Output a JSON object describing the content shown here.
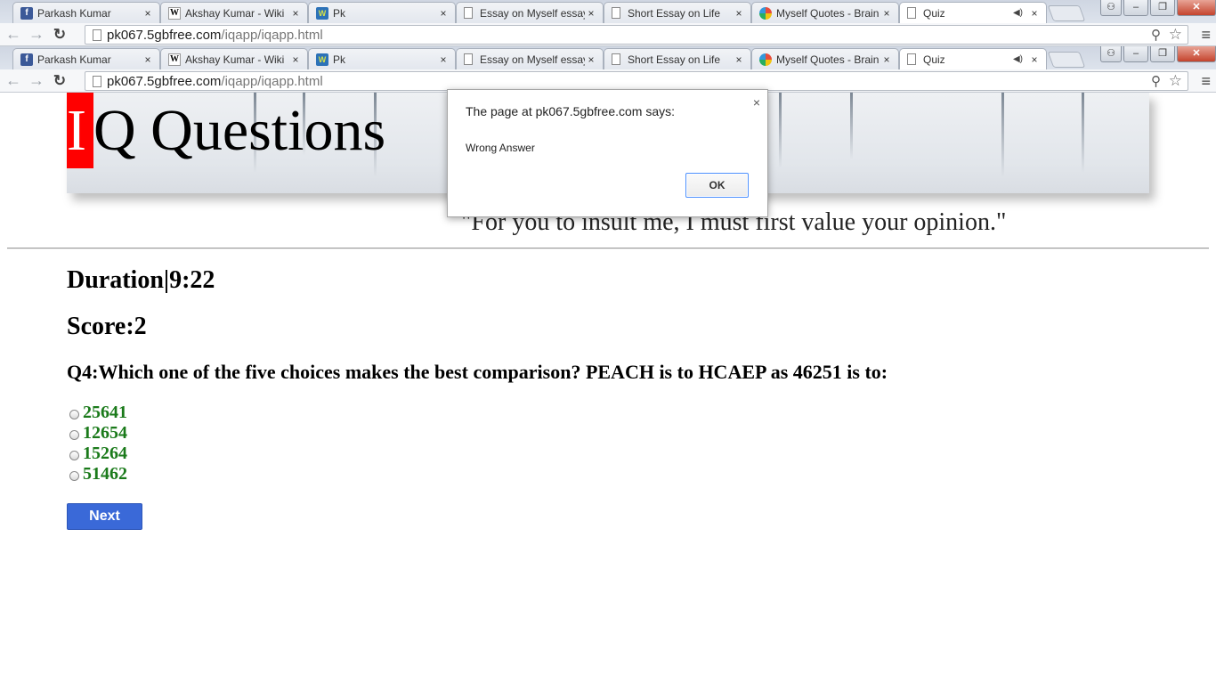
{
  "browser": {
    "tabs": [
      {
        "title": "Parkash Kumar",
        "icon": "facebook-icon"
      },
      {
        "title": "Akshay Kumar - Wiki",
        "icon": "wikipedia-icon"
      },
      {
        "title": "Pk",
        "icon": "wordpress-icon"
      },
      {
        "title": "Essay on Myself essay",
        "icon": "document-icon"
      },
      {
        "title": "Short Essay on Life",
        "icon": "document-icon"
      },
      {
        "title": "Myself Quotes - Brain",
        "icon": "brainyquote-icon"
      },
      {
        "title": "Quiz",
        "icon": "document-icon",
        "active": true,
        "audio": true
      }
    ],
    "url_domain": "pk067.5gbfree.com",
    "url_path": "/iqapp/iqapp.html",
    "close_glyph": "×",
    "window_buttons": {
      "user": "⚇",
      "minimize": "–",
      "restore": "❐",
      "close": "✕"
    }
  },
  "page": {
    "logo_first": "I",
    "logo_rest": "Q Questions",
    "quote": "\"For you to insult me, I must first value your opinion.\"",
    "duration_label": "Duration|9:22",
    "score_label": "Score:2",
    "question": "Q4:Which one of the five choices makes the best comparison? PEACH is to HCAEP as 46251 is to:",
    "options": [
      "25641",
      "12654",
      "15264",
      "51462"
    ],
    "next_label": "Next"
  },
  "dialog": {
    "title": "The page at pk067.5gbfree.com says:",
    "message": "Wrong Answer",
    "ok_label": "OK",
    "close_glyph": "×"
  },
  "colors": {
    "logo_red": "#ff0000",
    "option_green": "#1a7a1a",
    "button_blue": "#3a69d8"
  }
}
